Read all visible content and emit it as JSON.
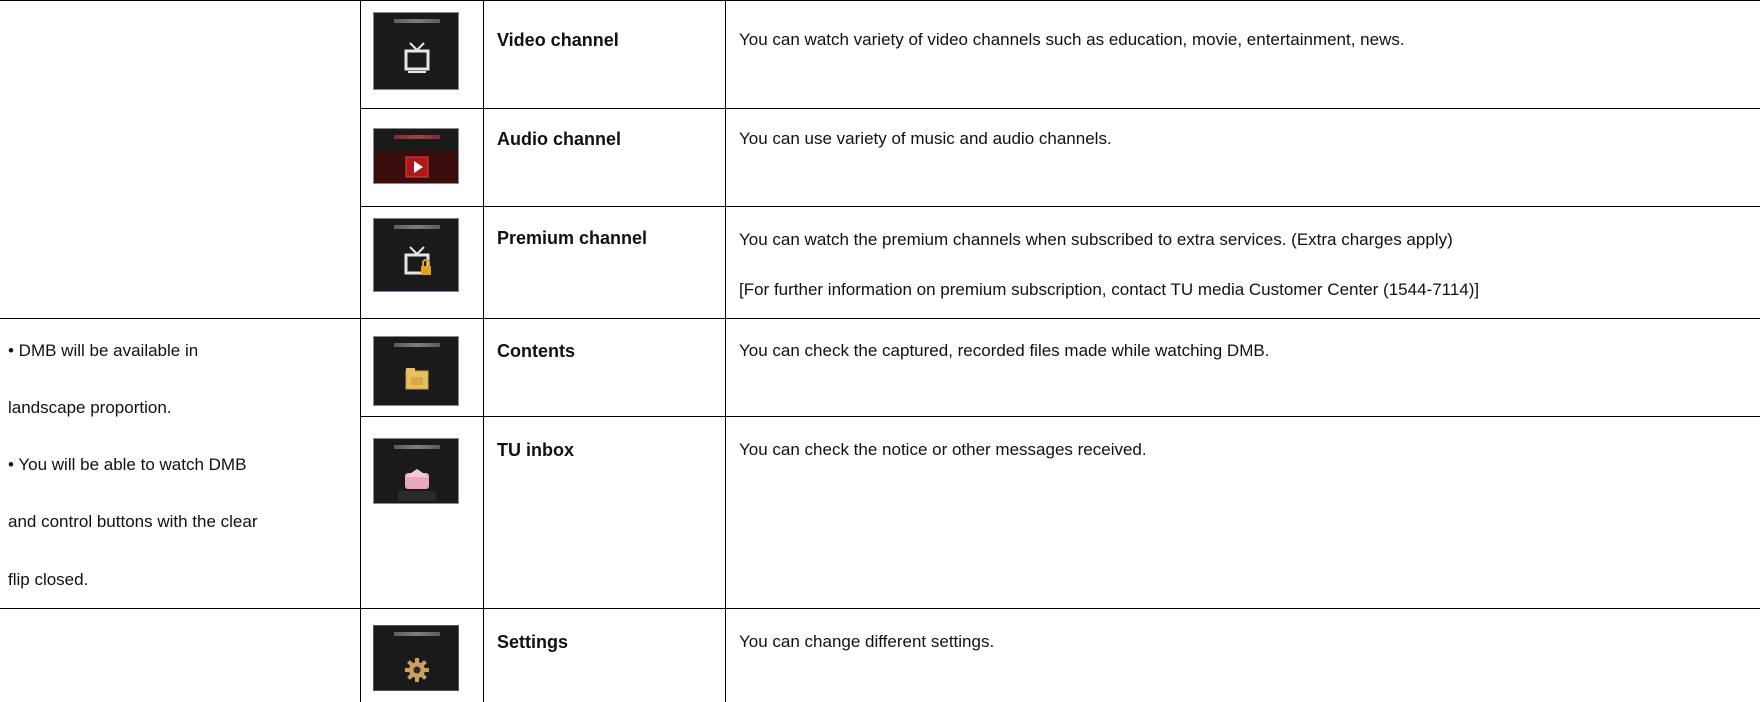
{
  "rows": [
    {
      "icon": "tv-icon",
      "name": "Video channel",
      "desc": [
        "You can watch variety of video channels such as education, movie, entertainment, news."
      ]
    },
    {
      "icon": "play-icon",
      "name": "Audio channel",
      "desc": [
        "You can use variety of music and audio channels."
      ]
    },
    {
      "icon": "tv-lock-icon",
      "name": "Premium channel",
      "desc": [
        "You can watch the premium channels when subscribed to extra services. (Extra charges apply)",
        "[For further information on premium subscription, contact TU media Customer Center (1544-7114)]"
      ]
    },
    {
      "icon": "folder-icon",
      "name": "Contents",
      "desc": [
        "You can check the captured, recorded files made while watching DMB."
      ]
    },
    {
      "icon": "envelope-icon",
      "name": "TU inbox",
      "desc": [
        "You can check the notice or other messages received."
      ]
    },
    {
      "icon": "gear-icon",
      "name": "Settings",
      "desc": [
        "You can change different settings."
      ]
    }
  ],
  "notes": [
    "• DMB will be available in",
    "landscape proportion.",
    "•  You will be able to watch DMB",
    "and control buttons with the clear",
    "flip closed."
  ]
}
